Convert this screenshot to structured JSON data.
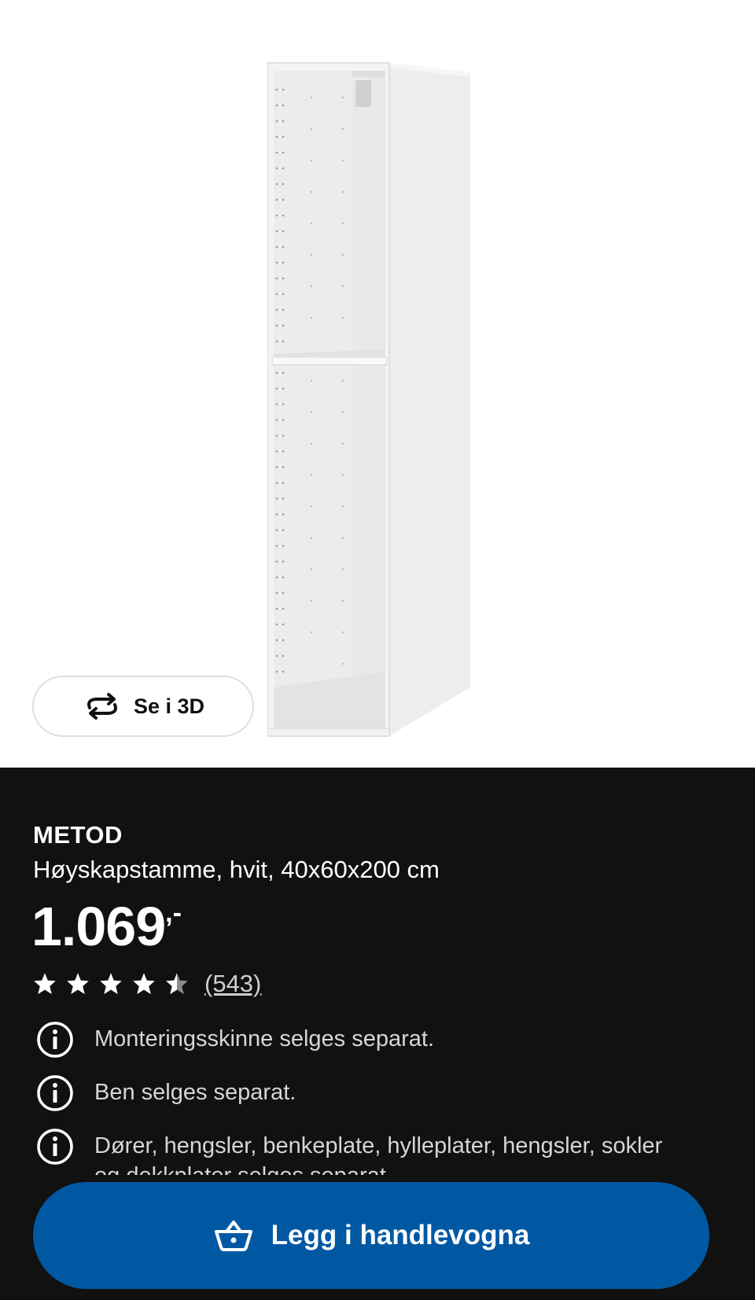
{
  "hero": {
    "view_3d_label": "Se i 3D"
  },
  "product": {
    "brand": "METOD",
    "description": "Høyskapstamme, hvit, 40x60x200 cm",
    "price_amount": "1.069",
    "price_suffix": ",-",
    "rating": 4.5,
    "rating_max": 5,
    "review_count": "(543)"
  },
  "notes": [
    {
      "text": "Monteringsskinne selges separat."
    },
    {
      "text": "Ben selges separat."
    },
    {
      "text": "Dører, hengsler, benkeplate, hylleplater, hengsler, sokler og dekkplater selges separat."
    }
  ],
  "cart": {
    "label": "Legg i handlevogna"
  },
  "colors": {
    "panel_bg": "#111111",
    "cart_blue": "#0058a3",
    "text_white": "#ffffff",
    "text_muted": "#d6d6d6"
  },
  "icons": {
    "view_3d": "rotate-arrows-icon",
    "info": "info-icon",
    "cart": "basket-icon",
    "star": "star-icon"
  }
}
